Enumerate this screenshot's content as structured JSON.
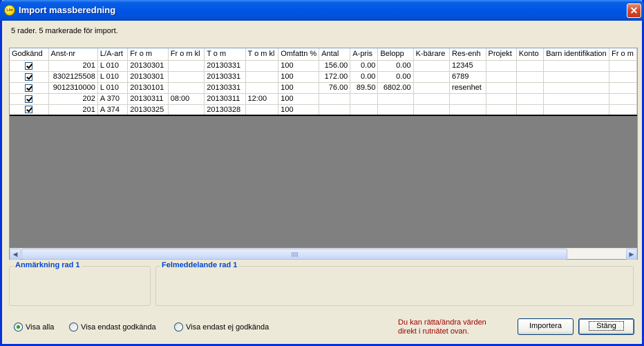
{
  "window": {
    "title": "Import massberedning",
    "icon_name": "app-icon",
    "icon_text": "Lön",
    "close_label": "✕"
  },
  "status": "5 rader. 5 markerade för import.",
  "grid": {
    "columns": [
      "Godkänd",
      "Anst-nr",
      "L/A-art",
      "Fr o m",
      "Fr o m kl",
      "T o m",
      "T o m kl",
      "Omfattn %",
      "Antal",
      "A-pris",
      "Belopp",
      "K-bärare",
      "Res-enh",
      "Projekt",
      "Konto",
      "Barn identifikation",
      "Fr o m"
    ],
    "rows": [
      {
        "godkand": true,
        "anst_nr": "201",
        "la_art": "L 010",
        "from": "20130301",
        "from_kl": "",
        "tom": "20130331",
        "tom_kl": "",
        "omfattn": "100",
        "antal": "156.00",
        "apris": "0.00",
        "belopp": "0.00",
        "kbarare": "",
        "resenh": "12345",
        "projekt": "",
        "konto": "",
        "barn": "",
        "from2": ""
      },
      {
        "godkand": true,
        "anst_nr": "8302125508",
        "la_art": "L 010",
        "from": "20130301",
        "from_kl": "",
        "tom": "20130331",
        "tom_kl": "",
        "omfattn": "100",
        "antal": "172.00",
        "apris": "0.00",
        "belopp": "0.00",
        "kbarare": "",
        "resenh": "6789",
        "projekt": "",
        "konto": "",
        "barn": "",
        "from2": ""
      },
      {
        "godkand": true,
        "anst_nr": "9012310000",
        "la_art": "L 010",
        "from": "20130101",
        "from_kl": "",
        "tom": "20130331",
        "tom_kl": "",
        "omfattn": "100",
        "antal": "76.00",
        "apris": "89.50",
        "belopp": "6802.00",
        "kbarare": "",
        "resenh": "resenhet",
        "projekt": "",
        "konto": "",
        "barn": "",
        "from2": ""
      },
      {
        "godkand": true,
        "anst_nr": "202",
        "la_art": "A 370",
        "from": "20130311",
        "from_kl": "08:00",
        "tom": "20130311",
        "tom_kl": "12:00",
        "omfattn": "100",
        "antal": "",
        "apris": "",
        "belopp": "",
        "kbarare": "",
        "resenh": "",
        "projekt": "",
        "konto": "",
        "barn": "",
        "from2": ""
      },
      {
        "godkand": true,
        "anst_nr": "201",
        "la_art": "A 374",
        "from": "20130325",
        "from_kl": "",
        "tom": "20130328",
        "tom_kl": "",
        "omfattn": "100",
        "antal": "",
        "apris": "",
        "belopp": "",
        "kbarare": "",
        "resenh": "",
        "projekt": "",
        "konto": "",
        "barn": "",
        "from2": ""
      }
    ]
  },
  "remarks": {
    "anmarkning_label": "Anmärkning rad 1",
    "felmeddelande_label": "Felmeddelande rad 1"
  },
  "filter": {
    "options": [
      "Visa alla",
      "Visa endast godkända",
      "Visa endast ej godkända"
    ],
    "selected": "Visa alla"
  },
  "hint": {
    "line1": "Du kan rätta/ändra värden",
    "line2": "direkt i rutnätet ovan."
  },
  "buttons": {
    "import_label": "Importera",
    "close_label": "Stäng"
  },
  "colors": {
    "title_bar": "#0055e5",
    "group_label": "#0046d5",
    "hint_text": "#a00000",
    "grid_empty": "#808080"
  }
}
